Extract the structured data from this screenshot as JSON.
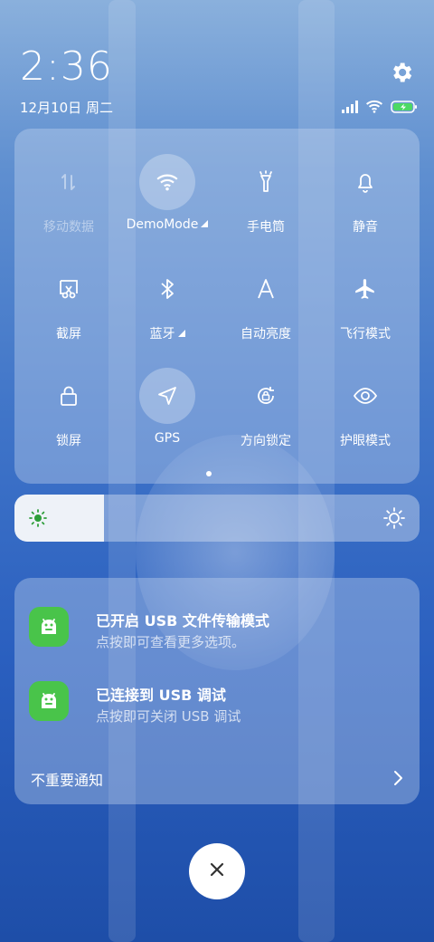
{
  "status_bar": {
    "time": "2:36",
    "date": "12月10日 周二"
  },
  "quick_settings": {
    "tiles": [
      {
        "label": "移动数据",
        "icon": "mobile-data-icon",
        "active": false,
        "disabled": true
      },
      {
        "label": "DemoMode",
        "icon": "wifi-icon",
        "active": true,
        "has_menu": true
      },
      {
        "label": "手电筒",
        "icon": "flashlight-icon",
        "active": false
      },
      {
        "label": "静音",
        "icon": "bell-icon",
        "active": false
      },
      {
        "label": "截屏",
        "icon": "screenshot-icon",
        "active": false
      },
      {
        "label": "蓝牙",
        "icon": "bluetooth-icon",
        "active": false,
        "has_menu": true
      },
      {
        "label": "自动亮度",
        "icon": "auto-brightness-icon",
        "active": false
      },
      {
        "label": "飞行模式",
        "icon": "airplane-icon",
        "active": false
      },
      {
        "label": "锁屏",
        "icon": "lock-icon",
        "active": false
      },
      {
        "label": "GPS",
        "icon": "location-arrow-icon",
        "active": true
      },
      {
        "label": "方向锁定",
        "icon": "rotation-lock-icon",
        "active": false
      },
      {
        "label": "护眼模式",
        "icon": "eye-icon",
        "active": false
      }
    ]
  },
  "brightness": {
    "level": 0.22
  },
  "notifications": [
    {
      "title": "已开启 USB 文件传输模式",
      "subtitle": "点按即可查看更多选项。",
      "icon": "android-icon"
    },
    {
      "title": "已连接到 USB 调试",
      "subtitle": "点按即可关闭 USB 调试",
      "icon": "android-icon"
    }
  ],
  "minor_notifications_label": "不重要通知",
  "colors": {
    "app_icon_green": "#49c44a",
    "battery_green": "#4cd964"
  }
}
